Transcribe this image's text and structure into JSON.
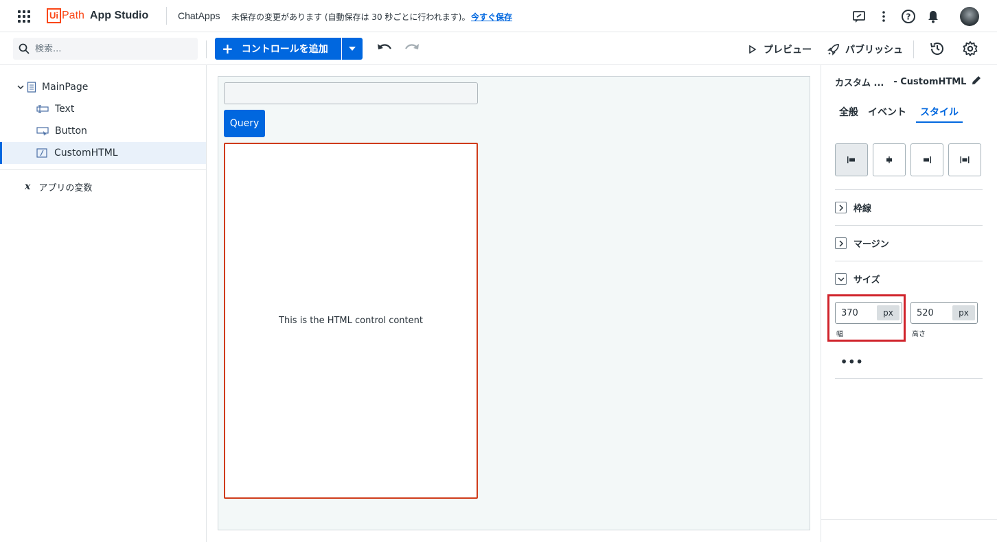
{
  "header": {
    "logo_ui": "Ui",
    "logo_path": "Path",
    "logo_app": "App Studio",
    "app_name": "ChatApps",
    "unsaved_message": "未保存の変更があります (自動保存は 30 秒ごとに行われます)。",
    "save_now_link": "今すぐ保存"
  },
  "toolbar": {
    "search_placeholder": "検索...",
    "add_control_label": "コントロールを追加",
    "preview_label": "プレビュー",
    "publish_label": "パブリッシュ"
  },
  "tree": {
    "page": "MainPage",
    "items": [
      {
        "label": "Text",
        "icon": "text-control-icon"
      },
      {
        "label": "Button",
        "icon": "button-control-icon"
      },
      {
        "label": "CustomHTML",
        "icon": "custom-html-icon",
        "selected": true
      }
    ],
    "variables_label": "アプリの変数"
  },
  "canvas": {
    "button_label": "Query",
    "html_content": "This is the HTML control content"
  },
  "properties": {
    "title": "カスタム ...",
    "subtitle": "- CustomHTML",
    "tabs": [
      "全般",
      "イベント",
      "スタイル"
    ],
    "active_tab": "スタイル",
    "sections": {
      "border": "枠線",
      "margin": "マージン",
      "size": "サイズ"
    },
    "width_value": "370",
    "width_unit": "px",
    "width_label": "幅",
    "height_value": "520",
    "height_unit": "px",
    "height_label": "高さ",
    "more_label": "•••"
  },
  "colors": {
    "accent": "#0067df",
    "brand": "#fa4616",
    "highlight": "#d0232b",
    "selection_border": "#cf3b1a"
  }
}
